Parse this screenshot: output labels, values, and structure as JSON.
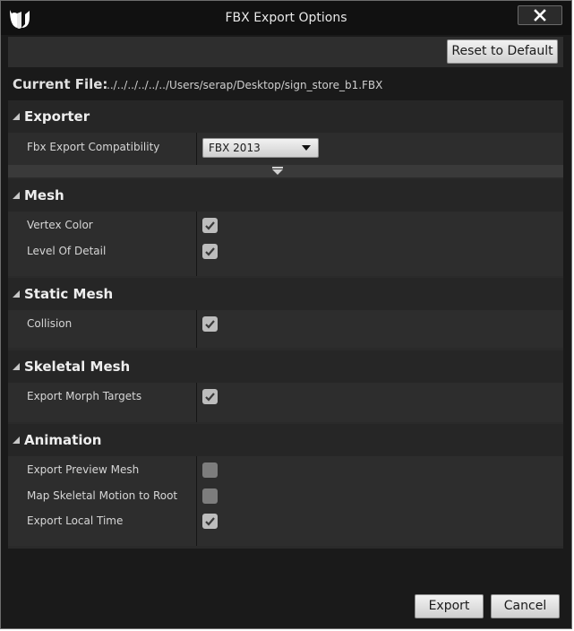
{
  "window": {
    "title": "FBX Export Options"
  },
  "toolbar": {
    "reset_label": "Reset to Default"
  },
  "current_file": {
    "label": "Current File:",
    "value": "../../../../../../Users/serap/Desktop/sign_store_b1.FBX"
  },
  "sections": {
    "exporter": {
      "title": "Exporter",
      "compat_label": "Fbx Export Compatibility",
      "compat_value": "FBX 2013"
    },
    "mesh": {
      "title": "Mesh",
      "rows": [
        {
          "label": "Vertex Color",
          "checked": true
        },
        {
          "label": "Level Of Detail",
          "checked": true
        }
      ]
    },
    "static_mesh": {
      "title": "Static Mesh",
      "rows": [
        {
          "label": "Collision",
          "checked": true
        }
      ]
    },
    "skeletal_mesh": {
      "title": "Skeletal Mesh",
      "rows": [
        {
          "label": "Export Morph Targets",
          "checked": true
        }
      ]
    },
    "animation": {
      "title": "Animation",
      "rows": [
        {
          "label": "Export Preview Mesh",
          "checked": false
        },
        {
          "label": "Map Skeletal Motion to Root",
          "checked": false
        },
        {
          "label": "Export Local Time",
          "checked": true
        }
      ]
    }
  },
  "footer": {
    "export_label": "Export",
    "cancel_label": "Cancel"
  },
  "icons": {
    "logo": "unreal-logo-icon",
    "close": "close-icon",
    "collapse": "triangle-collapse-icon",
    "expand": "expand-arrow-icon",
    "check": "checkmark-icon"
  },
  "colors": {
    "window_bg": "#1a1a1a",
    "panel_bg": "#2d2d2d",
    "header_bg": "#262626",
    "text": "#d6d6d6",
    "button_bg": "#dcdcdc"
  }
}
